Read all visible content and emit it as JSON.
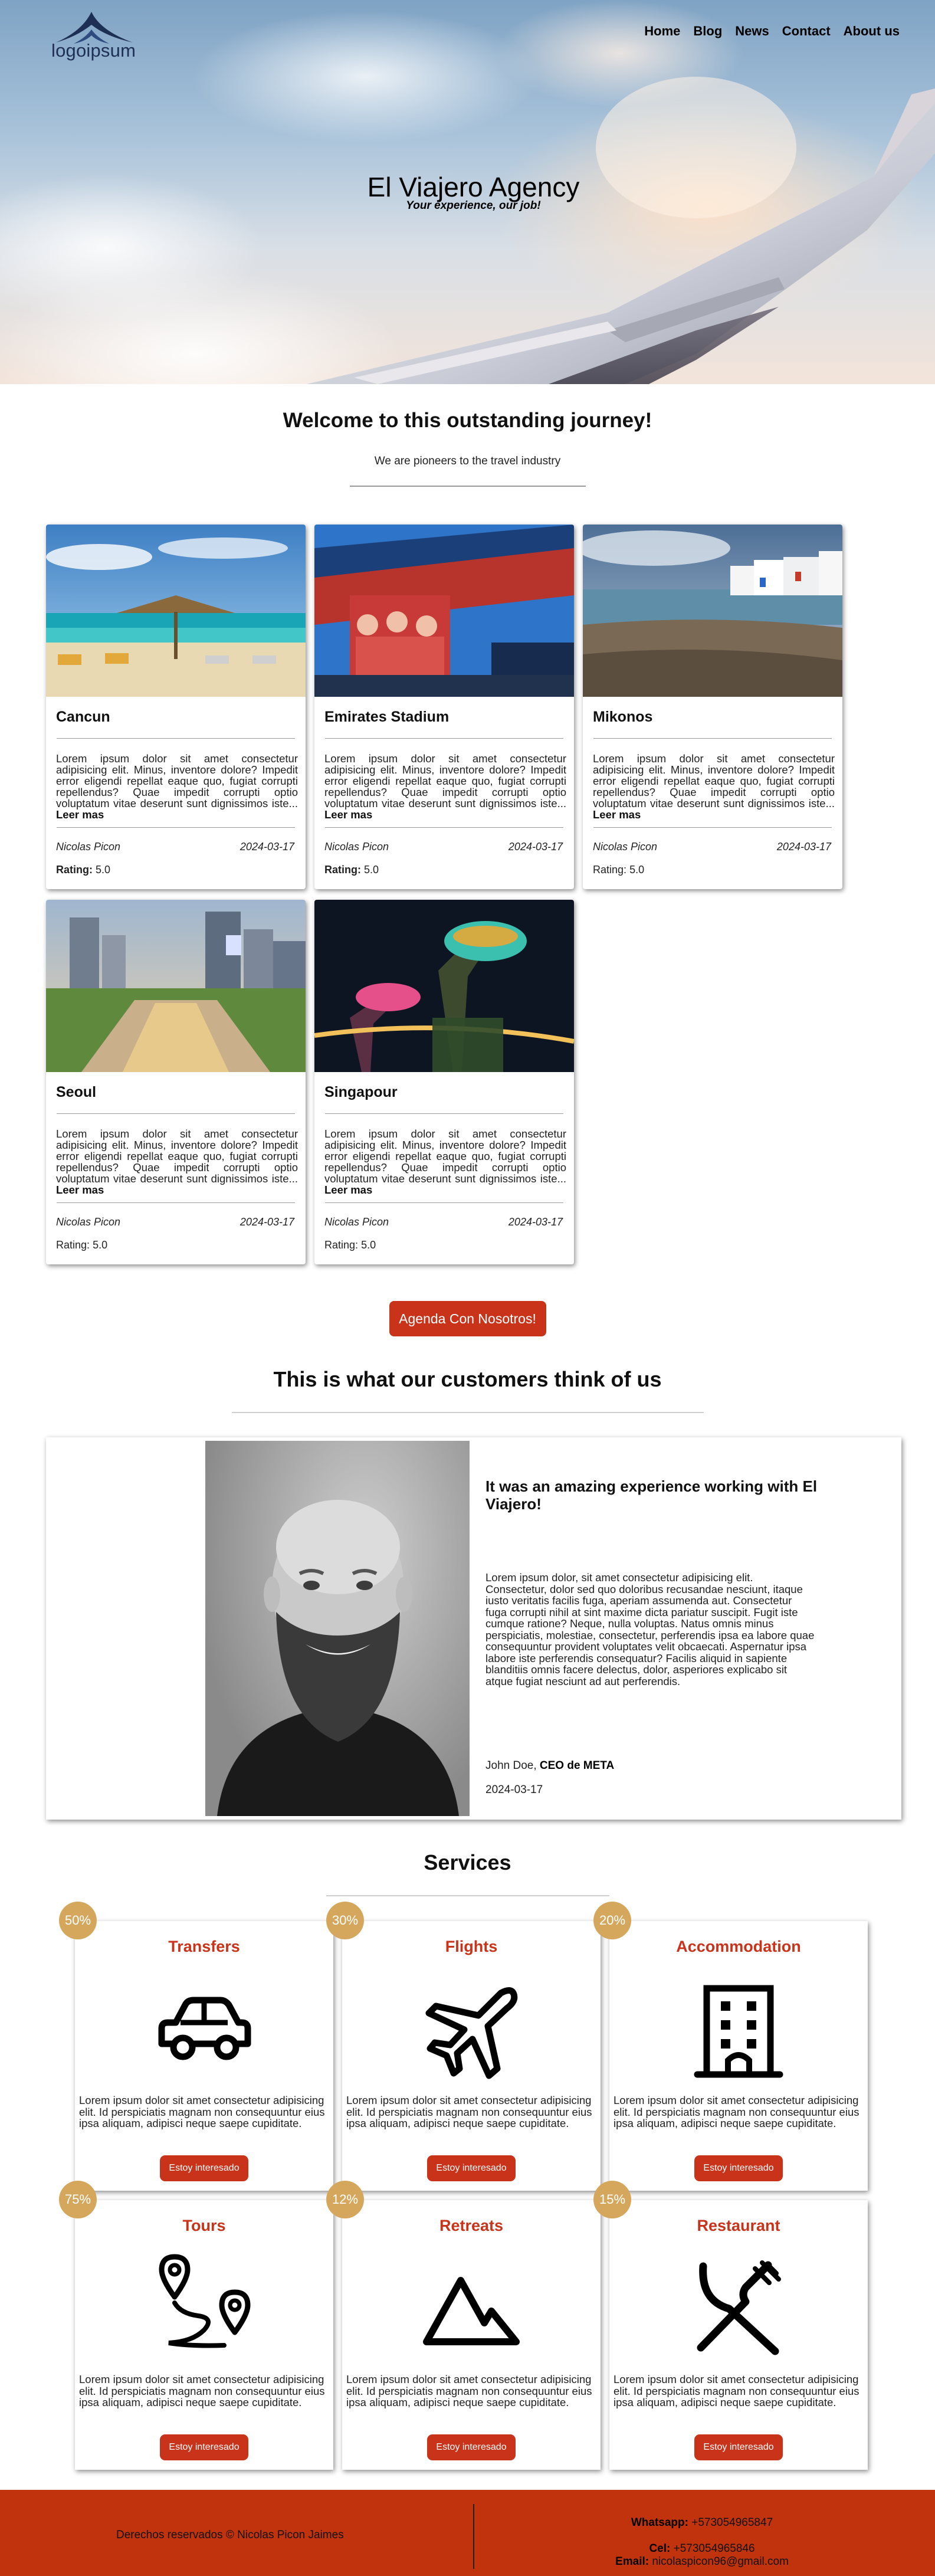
{
  "header": {
    "logo_text": "logoipsum",
    "nav": [
      "Home",
      "Blog",
      "News",
      "Contact",
      "About us"
    ],
    "title": "El Viajero Agency",
    "subtitle": "Your experience, our job!"
  },
  "welcome": {
    "title": "Welcome to this outstanding journey!",
    "subtitle": "We are pioneers to the travel industry"
  },
  "destinations": [
    {
      "title": "Cancun",
      "text": "Lorem ipsum dolor sit amet consectetur adipisicing elit. Minus, inventore dolore? Impedit error eligendi repellat eaque quo, fugiat corrupti repellendus? Quae impedit corrupti optio voluptatum vitae deserunt sunt dignissimos iste...",
      "more": "Leer mas",
      "author": "Nicolas Picon",
      "date": "2024-03-17",
      "rating_label": "Rating:",
      "rating": "5.0"
    },
    {
      "title": "Emirates Stadium",
      "text": "Lorem ipsum dolor sit amet consectetur adipisicing elit. Minus, inventore dolore? Impedit error eligendi repellat eaque quo, fugiat corrupti repellendus? Quae impedit corrupti optio voluptatum vitae deserunt sunt dignissimos iste...",
      "more": "Leer mas",
      "author": "Nicolas Picon",
      "date": "2024-03-17",
      "rating_label": "Rating:",
      "rating": "5.0"
    },
    {
      "title": "Mikonos",
      "text": "Lorem ipsum dolor sit amet consectetur adipisicing elit. Minus, inventore dolore? Impedit error eligendi repellat eaque quo, fugiat corrupti repellendus? Quae impedit corrupti optio voluptatum vitae deserunt sunt dignissimos iste...",
      "more": "Leer mas",
      "author": "Nicolas Picon",
      "date": "2024-03-17",
      "rating_label": "Rating:",
      "rating": "5.0"
    },
    {
      "title": "Seoul",
      "text": "Lorem ipsum dolor sit amet consectetur adipisicing elit. Minus, inventore dolore? Impedit error eligendi repellat eaque quo, fugiat corrupti repellendus? Quae impedit corrupti optio voluptatum vitae deserunt sunt dignissimos iste...",
      "more": "Leer mas",
      "author": "Nicolas Picon",
      "date": "2024-03-17",
      "rating_label": "Rating:",
      "rating": "5.0"
    },
    {
      "title": "Singapour",
      "text": "Lorem ipsum dolor sit amet consectetur adipisicing elit. Minus, inventore dolore? Impedit error eligendi repellat eaque quo, fugiat corrupti repellendus? Quae impedit corrupti optio voluptatum vitae deserunt sunt dignissimos iste...",
      "more": "Leer mas",
      "author": "Nicolas Picon",
      "date": "2024-03-17",
      "rating_label": "Rating:",
      "rating": "5.0"
    }
  ],
  "cta_label": "Agenda Con Nosotros!",
  "testimonials": {
    "title": "This is what our customers think of us",
    "heading": "It was an amazing experience working with El Viajero!",
    "text": "Lorem ipsum dolor, sit amet consectetur adipisicing elit. Consectetur, dolor sed quo doloribus recusandae nesciunt, itaque iusto veritatis facilis fuga, aperiam assumenda aut. Consectetur fuga corrupti nihil at sint maxime dicta pariatur suscipit. Fugit iste cumque ratione? Neque, nulla voluptas. Natus omnis minus perspiciatis, molestiae, consectetur, perferendis ipsa ea labore quae consequuntur provident voluptates velit obcaecati. Aspernatur ipsa labore iste perferendis consequatur? Facilis aliquid in sapiente blanditiis omnis facere delectus, dolor, asperiores explicabo sit atque fugiat nesciunt ad aut perferendis.",
    "author_name": "John Doe,",
    "author_role": "CEO de META",
    "date": "2024-03-17"
  },
  "services": {
    "title": "Services",
    "items": [
      {
        "badge": "50%",
        "title": "Transfers",
        "icon": "car-icon",
        "text": "Lorem ipsum dolor sit amet consectetur adipisicing elit. Id perspiciatis magnam non consequuntur eius ipsa aliquam, adipisci neque saepe cupiditate.",
        "button": "Estoy interesado"
      },
      {
        "badge": "30%",
        "title": "Flights",
        "icon": "airplane-icon",
        "text": "Lorem ipsum dolor sit amet consectetur adipisicing elit. Id perspiciatis magnam non consequuntur eius ipsa aliquam, adipisci neque saepe cupiditate.",
        "button": "Estoy interesado"
      },
      {
        "badge": "20%",
        "title": "Accommodation",
        "icon": "hotel-icon",
        "text": "Lorem ipsum dolor sit amet consectetur adipisicing elit. Id perspiciatis magnam non consequuntur eius ipsa aliquam, adipisci neque saepe cupiditate.",
        "button": "Estoy interesado"
      },
      {
        "badge": "75%",
        "title": "Tours",
        "icon": "route-pins-icon",
        "text": "Lorem ipsum dolor sit amet consectetur adipisicing elit. Id perspiciatis magnam non consequuntur eius ipsa aliquam, adipisci neque saepe cupiditate.",
        "button": "Estoy interesado"
      },
      {
        "badge": "12%",
        "title": "Retreats",
        "icon": "mountain-icon",
        "text": "Lorem ipsum dolor sit amet consectetur adipisicing elit. Id perspiciatis magnam non consequuntur eius ipsa aliquam, adipisci neque saepe cupiditate.",
        "button": "Estoy interesado"
      },
      {
        "badge": "15%",
        "title": "Restaurant",
        "icon": "fork-knife-icon",
        "text": "Lorem ipsum dolor sit amet consectetur adipisicing elit. Id perspiciatis magnam non consequuntur eius ipsa aliquam, adipisci neque saepe cupiditate.",
        "button": "Estoy interesado"
      }
    ]
  },
  "footer": {
    "copyright": "Derechos reservados © Nicolas Picon Jaimes",
    "whatsapp_label": "Whatsapp:",
    "whatsapp": "+573054965847",
    "cel_label": "Cel:",
    "cel": "+573054965846",
    "email_label": "Email:",
    "email": "nicolaspicon96@gmail.com"
  },
  "colors": {
    "accent": "#c8331a",
    "badge": "#d4a75c",
    "footer": "#c1330d",
    "logo": "#1e2f55"
  }
}
